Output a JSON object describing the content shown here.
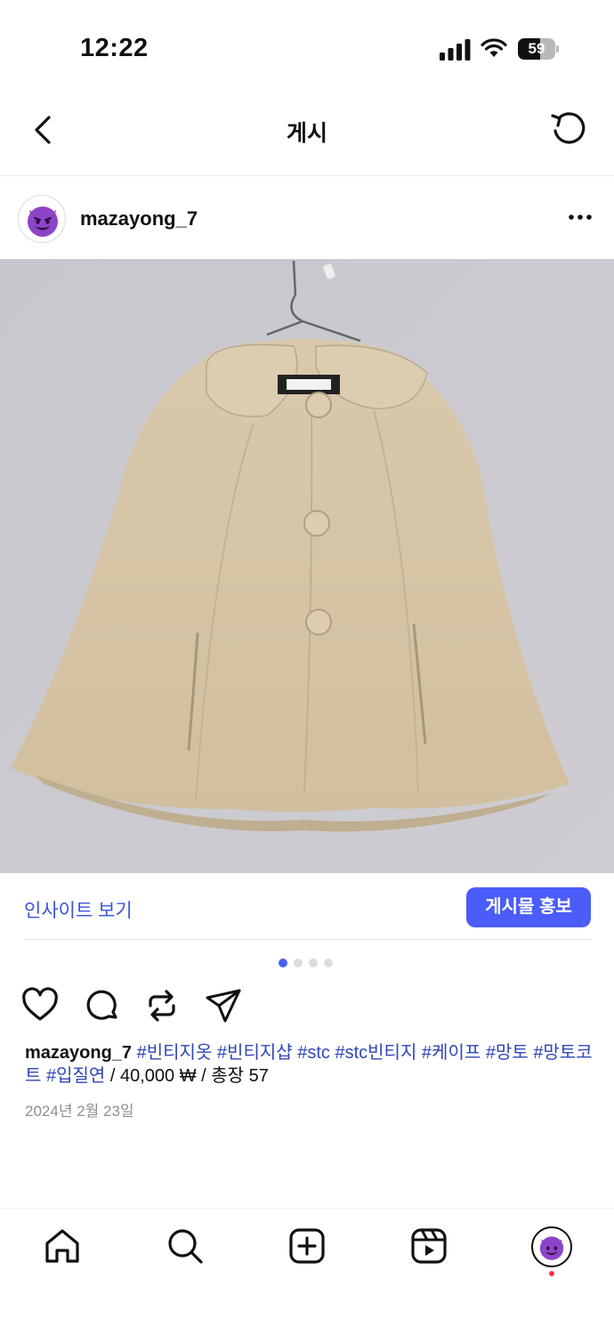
{
  "status_bar": {
    "time": "12:22",
    "battery": "59",
    "battery_level": 0.59
  },
  "header": {
    "title": "게시"
  },
  "post": {
    "username": "mazayong_7",
    "insight_link": "인사이트 보기",
    "promote_button": "게시물 홍보",
    "carousel": {
      "count": 4,
      "active_index": 0
    },
    "caption": {
      "username": "mazayong_7",
      "hashtags": [
        "#빈티지옷",
        "#빈티지샵",
        "#stc",
        "#stc빈티지",
        "#케이프",
        "#망토",
        "#망토코트",
        "#입질연"
      ],
      "text": "/ 40,000 ₩ / 총장 57"
    },
    "date": "2024년 2월 23일"
  },
  "icons": {
    "back": "chevron-left-icon",
    "refresh": "refresh-icon",
    "more": "more-horizontal-icon",
    "like": "heart-icon",
    "comment": "comment-icon",
    "repost": "repost-icon",
    "share": "send-icon",
    "nav": [
      "home-icon",
      "search-icon",
      "create-icon",
      "reels-icon",
      "profile-avatar"
    ]
  },
  "colors": {
    "accent": "#4a5df9",
    "link": "#3a54d9",
    "hashtag": "#2f46b8",
    "dot_active": "#4a5df9",
    "notification": "#ff3040"
  }
}
